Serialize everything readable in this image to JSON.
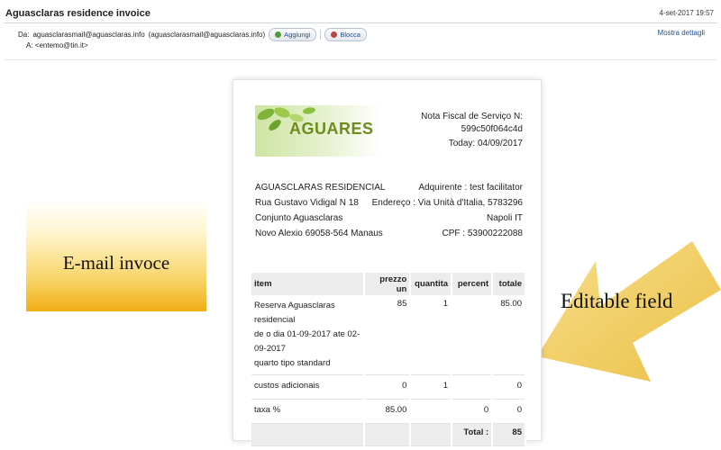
{
  "header": {
    "subject": "Aguasclaras residence invoice",
    "date": "4-set-2017 19:57",
    "from_label": "Da:",
    "from_name": "aguasclarasmail@aguasclaras.info",
    "from_email": "(aguasclarasmail@aguasclaras.info)",
    "add_label": "Aggiungi",
    "block_label": "Blocca",
    "to_label": "A:",
    "to_email": "<entemo@tin.it>",
    "details_label": "Mostra dettagli"
  },
  "annotations": {
    "left_box": "E-mail invoce",
    "arrow": "Editable field"
  },
  "invoice": {
    "logo_text": "AGUARES",
    "nf_label": "Nota Fiscal de Serviço N:",
    "nf_number": "599c50f064c4d",
    "nf_date": "Today: 04/09/2017",
    "seller": [
      "AGUASCLARAS RESIDENCIAL",
      "Rua Gustavo Vidigal N 18",
      "Conjunto Aguasclaras",
      "Novo Alexio 69058-564 Manaus"
    ],
    "buyer": [
      "Adquirente : test facilitator",
      "Endereço : Via Unità d'Italia, 5783296",
      "Napoli IT",
      "CPF : 53900222088"
    ],
    "table": {
      "headers": [
        "item",
        "prezzo un",
        "quantita",
        "percent",
        "totale"
      ],
      "rows": [
        {
          "item_lines": [
            "Reserva Aguasclaras residencial",
            "de o dia 01-09-2017 ate 02-09-2017",
            "quarto tipo standard"
          ],
          "prezzo": "85",
          "quantita": "1",
          "percent": "",
          "totale": "85.00"
        },
        {
          "item_lines": [
            "custos adicionais"
          ],
          "prezzo": "0",
          "quantita": "1",
          "percent": "",
          "totale": "0"
        },
        {
          "item_lines": [
            "taxa %"
          ],
          "prezzo": "85.00",
          "quantita": "",
          "percent": "0",
          "totale": "0"
        }
      ],
      "total_label": "Total :",
      "total_value": "85"
    }
  },
  "colors": {
    "link": "#1d4f8f",
    "arrow": "#f5c842",
    "box": "#f2ae17"
  }
}
